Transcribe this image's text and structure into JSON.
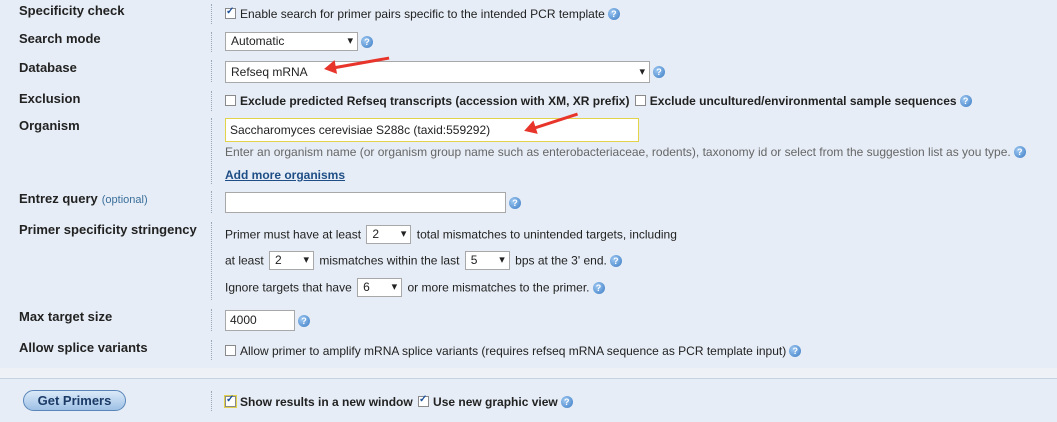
{
  "rows": {
    "specificity": {
      "label": "Specificity check",
      "checkbox_label": "Enable search for primer pairs specific to the intended PCR template",
      "checked": true
    },
    "search_mode": {
      "label": "Search mode",
      "value": "Automatic"
    },
    "database": {
      "label": "Database",
      "value": "Refseq mRNA"
    },
    "exclusion": {
      "label": "Exclusion",
      "opt1": "Exclude predicted Refseq transcripts (accession with XM, XR prefix)",
      "opt2": "Exclude uncultured/environmental sample sequences"
    },
    "organism": {
      "label": "Organism",
      "value": "Saccharomyces cerevisiae S288c (taxid:559292)",
      "hint": "Enter an organism name (or organism group name such as enterobacteriaceae, rodents), taxonomy id or select from the suggestion list as you type.",
      "add_more": "Add more organisms"
    },
    "entrez": {
      "label": "Entrez query",
      "optional": "(optional)",
      "value": ""
    },
    "stringency": {
      "label": "Primer specificity stringency",
      "line1_prefix": "Primer must have at least",
      "line1_value": "2",
      "line1_suffix": "total mismatches to unintended targets, including",
      "line2_prefix": "at least",
      "line2_value": "2",
      "line2_mid": "mismatches within the last",
      "line2_value2": "5",
      "line2_suffix": "bps at the 3' end.",
      "line3_prefix": "Ignore targets that have",
      "line3_value": "6",
      "line3_suffix": "or more mismatches to the primer."
    },
    "max_target": {
      "label": "Max target size",
      "value": "4000"
    },
    "splice": {
      "label": "Allow splice variants",
      "checkbox_label": "Allow primer to amplify mRNA splice variants (requires refseq mRNA sequence as PCR template input)"
    }
  },
  "footer": {
    "button": "Get Primers",
    "opt1": "Show results in a new window",
    "opt2": "Use new graphic view"
  },
  "icons": {
    "help": "help-icon",
    "arrow": "red-arrow-annotation"
  }
}
